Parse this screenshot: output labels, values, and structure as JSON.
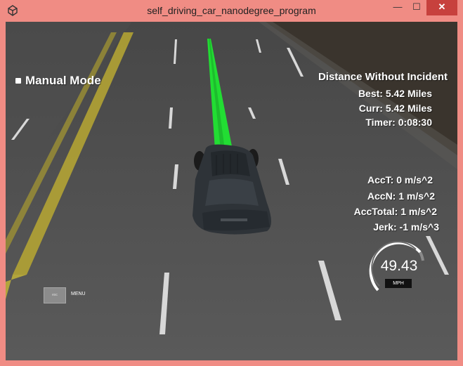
{
  "window": {
    "title": "self_driving_car_nanodegree_program",
    "controls": {
      "minimize": "—",
      "maximize": "☐",
      "close": "✕"
    },
    "accent": "#f08c84",
    "app_icon": "unity-icon"
  },
  "hud": {
    "mode_label": "Manual Mode",
    "distance_title": "Distance Without Incident",
    "best": "Best: 5.42 Miles",
    "curr": "Curr: 5.42 Miles",
    "timer": "Timer: 0:08:30",
    "acc_t": "AccT: 0 m/s^2",
    "acc_n": "AccN: 1 m/s^2",
    "acc_total": "AccTotal: 1 m/s^2",
    "jerk": "Jerk: -1 m/s^3",
    "menu_button": "esc",
    "menu_label": "MENU",
    "speed_value": "49.43",
    "speed_unit": "MPH",
    "path_color": "#22dd33"
  }
}
